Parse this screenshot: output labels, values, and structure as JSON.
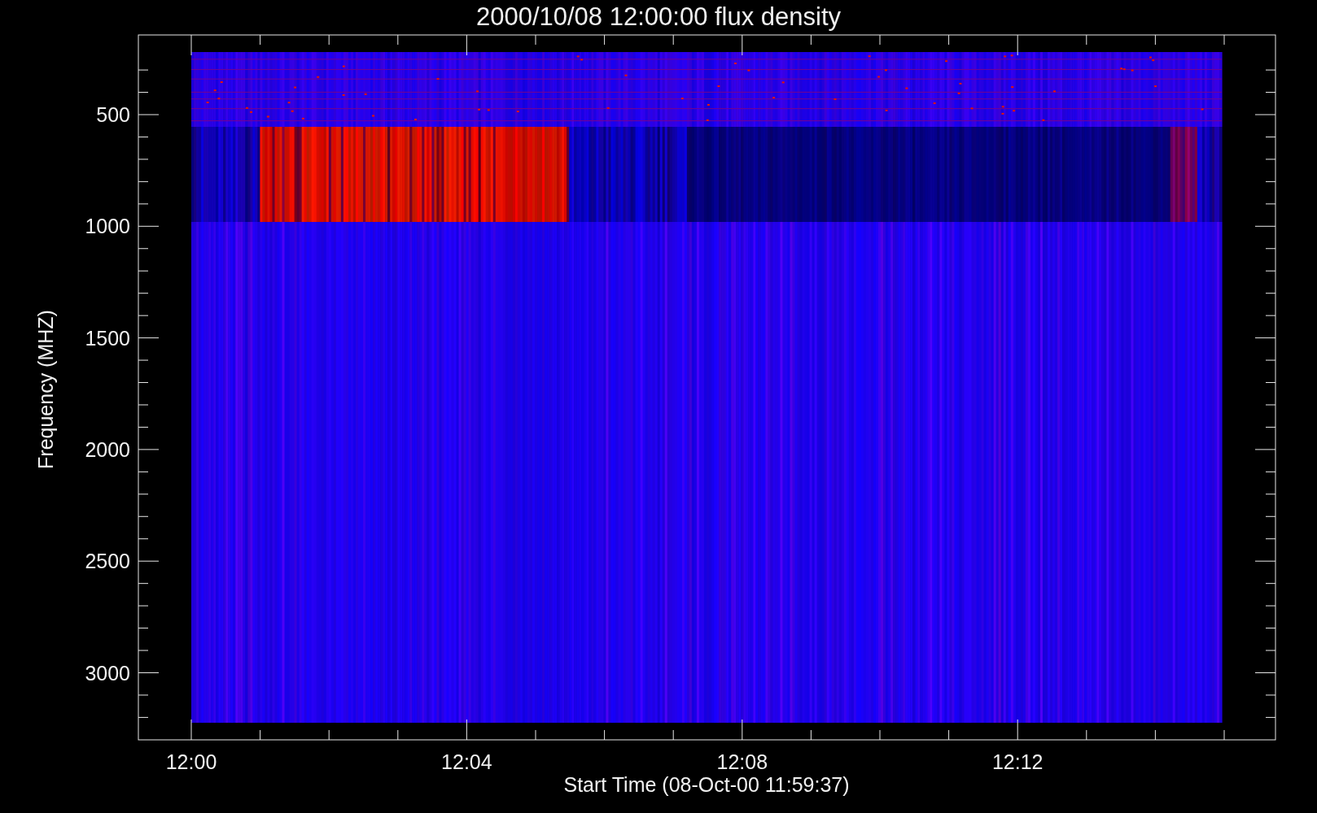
{
  "title": "2000/10/08 12:00:00 flux density",
  "plot": {
    "xlabel": "Start Time (08-Oct-00 11:59:37)",
    "ylabel": "Frequency (MHZ)",
    "xticks": [
      "12:00",
      "12:04",
      "12:08",
      "12:12"
    ],
    "yticks": [
      "500",
      "1000",
      "1500",
      "2000",
      "2500",
      "3000"
    ]
  }
}
